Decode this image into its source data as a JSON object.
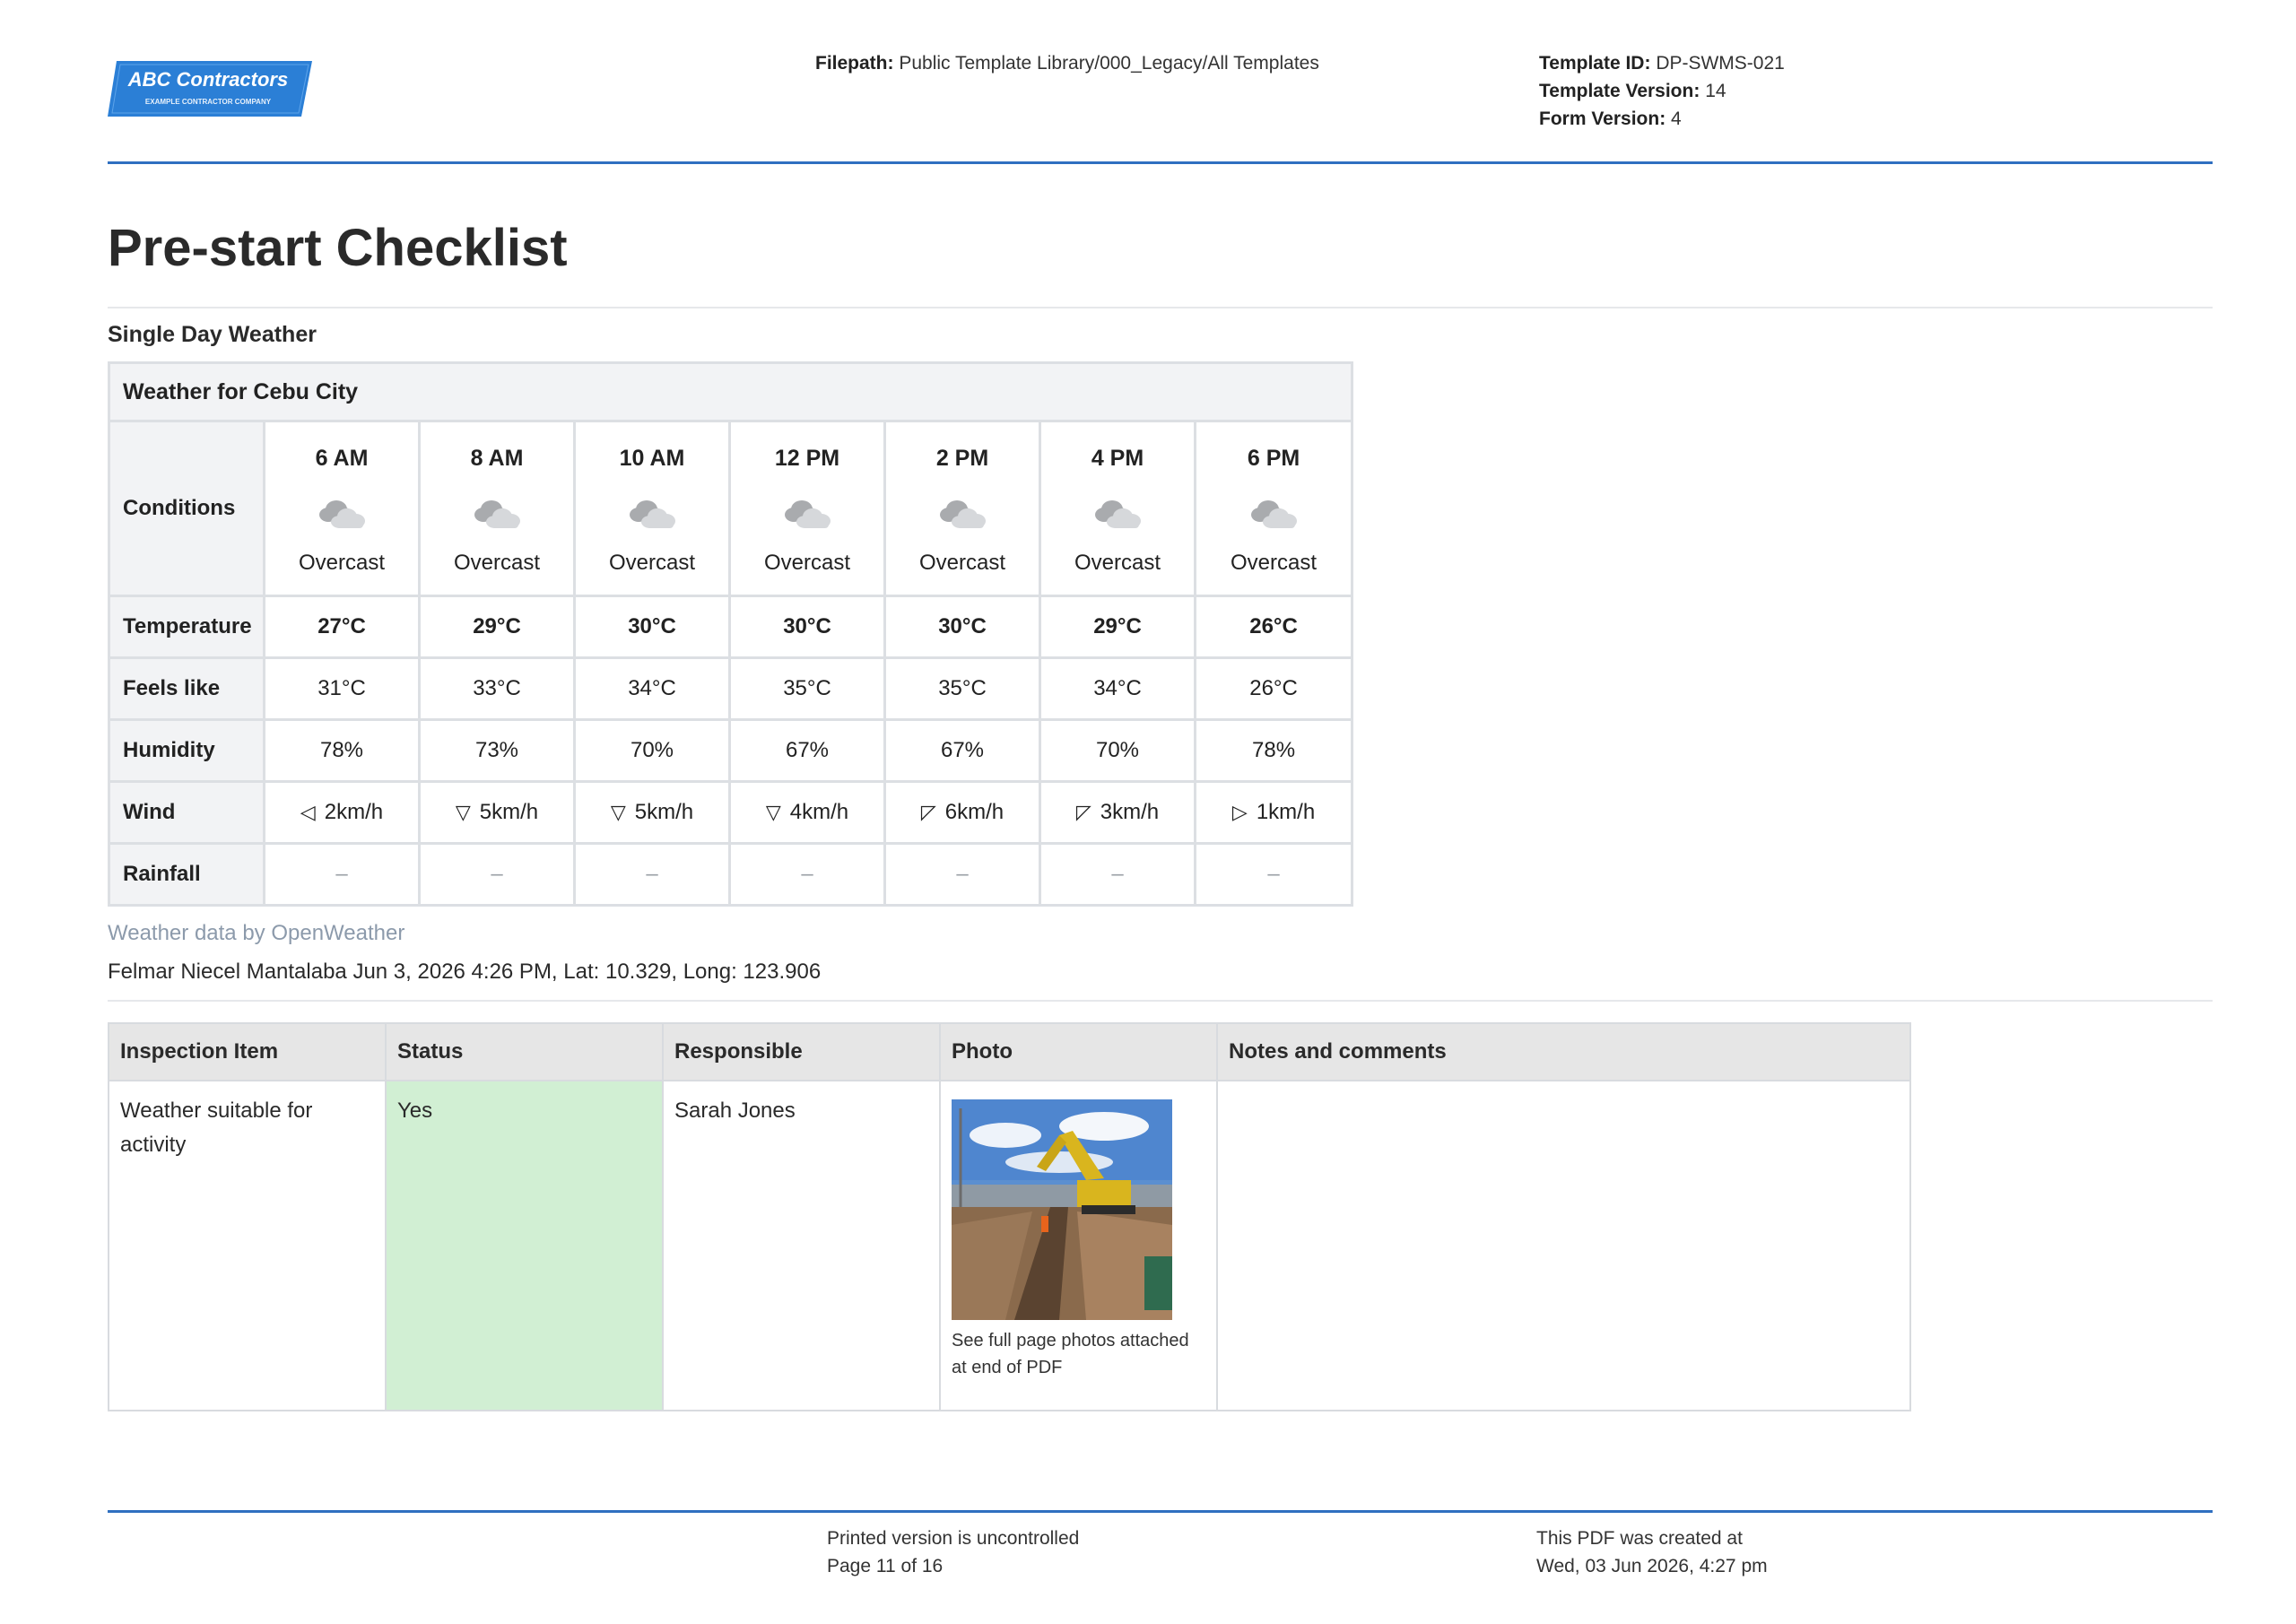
{
  "header": {
    "logo_text": "ABC Contractors",
    "logo_subtext": "EXAMPLE CONTRACTOR COMPANY",
    "filepath_label": "Filepath:",
    "filepath_value": "Public Template Library/000_Legacy/All Templates",
    "template_id_label": "Template ID:",
    "template_id_value": "DP-SWMS-021",
    "template_version_label": "Template Version:",
    "template_version_value": "14",
    "form_version_label": "Form Version:",
    "form_version_value": "4"
  },
  "page_title": "Pre-start Checklist",
  "section_label": "Single Day Weather",
  "weather": {
    "caption": "Weather for Cebu City",
    "row_labels": {
      "conditions": "Conditions",
      "temperature": "Temperature",
      "feels_like": "Feels like",
      "humidity": "Humidity",
      "wind": "Wind",
      "rainfall": "Rainfall"
    },
    "hours": [
      {
        "time": "6 AM",
        "condition": "Overcast",
        "icon": "overcast-cloud-icon",
        "temp": "27°C",
        "feels": "31°C",
        "humidity": "78%",
        "wind_dir": "west",
        "wind_arrow": "◁",
        "wind": "2km/h",
        "rain": "–"
      },
      {
        "time": "8 AM",
        "condition": "Overcast",
        "icon": "overcast-cloud-icon",
        "temp": "29°C",
        "feels": "33°C",
        "humidity": "73%",
        "wind_dir": "south",
        "wind_arrow": "▽",
        "wind": "5km/h",
        "rain": "–"
      },
      {
        "time": "10 AM",
        "condition": "Overcast",
        "icon": "overcast-cloud-icon",
        "temp": "30°C",
        "feels": "34°C",
        "humidity": "70%",
        "wind_dir": "south",
        "wind_arrow": "▽",
        "wind": "5km/h",
        "rain": "–"
      },
      {
        "time": "12 PM",
        "condition": "Overcast",
        "icon": "overcast-cloud-icon",
        "temp": "30°C",
        "feels": "35°C",
        "humidity": "67%",
        "wind_dir": "south",
        "wind_arrow": "▽",
        "wind": "4km/h",
        "rain": "–"
      },
      {
        "time": "2 PM",
        "condition": "Overcast",
        "icon": "overcast-cloud-icon",
        "temp": "30°C",
        "feels": "35°C",
        "humidity": "67%",
        "wind_dir": "north-west",
        "wind_arrow": "◸",
        "wind": "6km/h",
        "rain": "–"
      },
      {
        "time": "4 PM",
        "condition": "Overcast",
        "icon": "overcast-cloud-icon",
        "temp": "29°C",
        "feels": "34°C",
        "humidity": "70%",
        "wind_dir": "north-west",
        "wind_arrow": "◸",
        "wind": "3km/h",
        "rain": "–"
      },
      {
        "time": "6 PM",
        "condition": "Overcast",
        "icon": "overcast-cloud-icon",
        "temp": "26°C",
        "feels": "26°C",
        "humidity": "78%",
        "wind_dir": "east",
        "wind_arrow": "▷",
        "wind": "1km/h",
        "rain": "–"
      }
    ],
    "credit": "Weather data by OpenWeather",
    "byline": "Felmar Niecel Mantalaba Jun 3, 2026 4:26 PM, Lat: 10.329, Long: 123.906"
  },
  "inspection": {
    "headers": [
      "Inspection Item",
      "Status",
      "Responsible",
      "Photo",
      "Notes and comments"
    ],
    "rows": [
      {
        "item": "Weather suitable for activity",
        "status": "Yes",
        "status_color": "#d1efd3",
        "responsible": "Sarah Jones",
        "photo_caption": "See full page photos attached at end of PDF",
        "notes": ""
      }
    ]
  },
  "footer": {
    "uncontrolled": "Printed version is uncontrolled",
    "page": "Page 11 of 16",
    "created_label": "This PDF was created at",
    "created_at": "Wed, 03 Jun 2026, 4:27 pm"
  },
  "colors": {
    "accent_blue": "#2f6fc0",
    "logo_blue": "#2b7fd6",
    "status_green": "#d1efd3",
    "credit_grey": "#8c9aab"
  }
}
